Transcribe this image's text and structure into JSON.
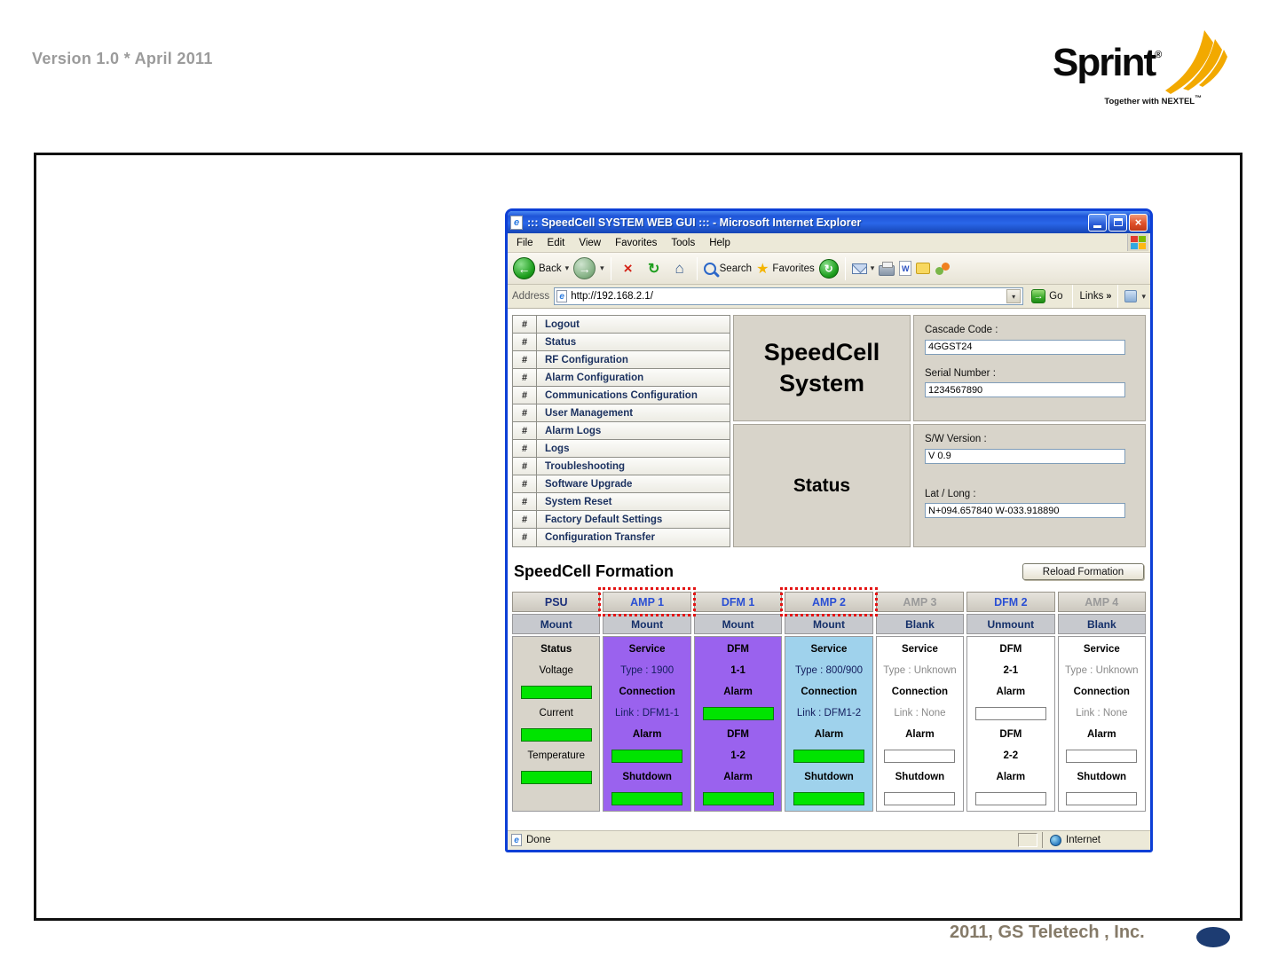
{
  "colors": {
    "amp_purple": "#9A62EE",
    "amp_light_blue": "#9FD2EC",
    "indicator_green": "#00E400",
    "highlight_red": "#E41414",
    "sprint_yellow": "#F2A900",
    "xp_title_blue": "#2A66E8"
  },
  "page": {
    "version_text": "Version 1.0 * April 2011",
    "footer_text": "2011, GS Teletech , Inc."
  },
  "logo": {
    "brand": "Sprint",
    "registered_mark": "®",
    "tagline": "Together with NEXTEL",
    "trademark": "™"
  },
  "browser": {
    "window_title": "::: SpeedCell SYSTEM WEB GUI ::: - Microsoft Internet Explorer",
    "menu_items": [
      "File",
      "Edit",
      "View",
      "Favorites",
      "Tools",
      "Help"
    ],
    "toolbar": {
      "back_label": "Back",
      "search_label": "Search",
      "favorites_label": "Favorites"
    },
    "address_label": "Address",
    "address_value": "http://192.168.2.1/",
    "go_label": "Go",
    "links_label": "Links",
    "status_done": "Done",
    "status_zone": "Internet"
  },
  "icons": {
    "close": "×",
    "back_arrow": "←",
    "forward_arrow": "→",
    "stop_x": "×",
    "refresh_arrows": "↻",
    "home_house": "⌂",
    "favorites_star": "★",
    "history_arrow": "↻",
    "go_arrow": "→",
    "links_chevrons": "»",
    "dropdown_arrow": "▾",
    "ie_logo": "e",
    "edit_w": "W"
  },
  "sidebar": {
    "hash": "#",
    "items": [
      {
        "label": "Logout"
      },
      {
        "label": "Status"
      },
      {
        "label": "RF Configuration"
      },
      {
        "label": "Alarm Configuration"
      },
      {
        "label": "Communications Configuration"
      },
      {
        "label": "User Management"
      },
      {
        "label": "Alarm Logs"
      },
      {
        "label": "Logs"
      },
      {
        "label": "Troubleshooting"
      },
      {
        "label": "Software Upgrade"
      },
      {
        "label": "System Reset"
      },
      {
        "label": "Factory Default Settings"
      },
      {
        "label": "Configuration Transfer"
      }
    ]
  },
  "panel": {
    "system_title": "SpeedCell System",
    "page_title": "Status",
    "fields": [
      {
        "label": "Cascade Code :",
        "value": "4GGST24"
      },
      {
        "label": "Serial Number :",
        "value": "1234567890"
      },
      {
        "label": "S/W Version :",
        "value": "V 0.9"
      },
      {
        "label": "Lat / Long :",
        "value": "N+094.657840 W-033.918890"
      }
    ]
  },
  "formation": {
    "title": "SpeedCell Formation",
    "reload_button": "Reload Formation",
    "psu": {
      "header": "PSU",
      "mount": "Mount",
      "status": "Status",
      "voltage": "Voltage",
      "current": "Current",
      "temperature": "Temperature"
    },
    "amp1": {
      "header": "AMP 1",
      "mount": "Mount",
      "service": "Service",
      "type": "Type : 1900",
      "connection": "Connection",
      "link": "Link : DFM1-1",
      "alarm": "Alarm",
      "shutdown": "Shutdown"
    },
    "dfm1": {
      "header": "DFM 1",
      "mount": "Mount",
      "dfm_a": "DFM",
      "port_a": "1-1",
      "alarm_a": "Alarm",
      "dfm_b": "DFM",
      "port_b": "1-2",
      "alarm_b": "Alarm"
    },
    "amp2": {
      "header": "AMP 2",
      "mount": "Mount",
      "service": "Service",
      "type": "Type : 800/900",
      "connection": "Connection",
      "link": "Link : DFM1-2",
      "alarm": "Alarm",
      "shutdown": "Shutdown"
    },
    "amp3": {
      "header": "AMP 3",
      "mount": "Blank",
      "service": "Service",
      "type": "Type : Unknown",
      "connection": "Connection",
      "link": "Link : None",
      "alarm": "Alarm",
      "shutdown": "Shutdown"
    },
    "dfm2": {
      "header": "DFM 2",
      "mount": "Unmount",
      "dfm_a": "DFM",
      "port_a": "2-1",
      "alarm_a": "Alarm",
      "dfm_b": "DFM",
      "port_b": "2-2",
      "alarm_b": "Alarm"
    },
    "amp4": {
      "header": "AMP 4",
      "mount": "Blank",
      "service": "Service",
      "type": "Type : Unknown",
      "connection": "Connection",
      "link": "Link : None",
      "alarm": "Alarm",
      "shutdown": "Shutdown"
    }
  }
}
